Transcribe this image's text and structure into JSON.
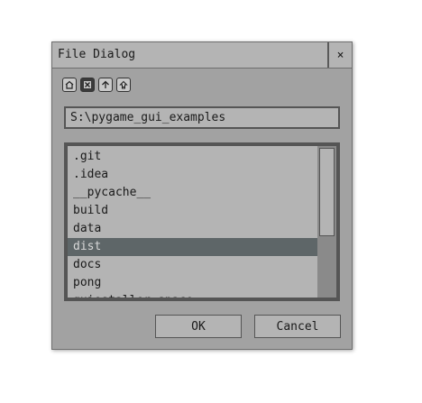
{
  "dialog": {
    "title": "File Dialog",
    "close_label": "×",
    "path": "S:\\pygame_gui_examples",
    "ok_label": "OK",
    "cancel_label": "Cancel"
  },
  "toolbar": {
    "items": [
      {
        "name": "home-icon"
      },
      {
        "name": "delete-icon"
      },
      {
        "name": "parent-directory-icon"
      },
      {
        "name": "refresh-icon"
      }
    ]
  },
  "files": {
    "items": [
      {
        "label": ".git",
        "selected": false
      },
      {
        "label": ".idea",
        "selected": false
      },
      {
        "label": "__pycache__",
        "selected": false
      },
      {
        "label": "build",
        "selected": false
      },
      {
        "label": "data",
        "selected": false
      },
      {
        "label": "dist",
        "selected": true
      },
      {
        "label": "docs",
        "selected": false
      },
      {
        "label": "pong",
        "selected": false
      },
      {
        "label": "quiestaller space",
        "selected": false
      }
    ]
  },
  "colors": {
    "dialog_bg": "#a2a2a2",
    "selected_bg": "#5e6668",
    "border": "#555555"
  }
}
